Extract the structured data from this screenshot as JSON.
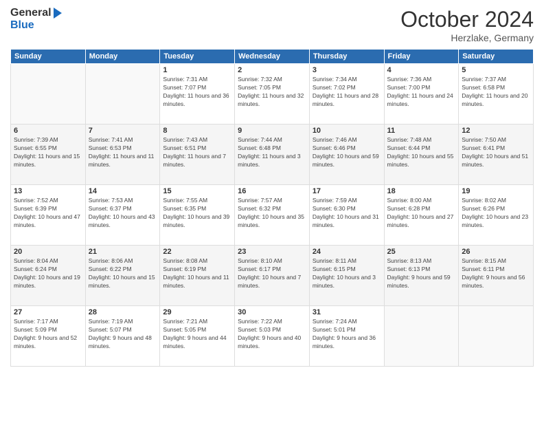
{
  "header": {
    "logo_general": "General",
    "logo_blue": "Blue",
    "month_title": "October 2024",
    "location": "Herzlake, Germany"
  },
  "weekdays": [
    "Sunday",
    "Monday",
    "Tuesday",
    "Wednesday",
    "Thursday",
    "Friday",
    "Saturday"
  ],
  "weeks": [
    [
      {
        "day": "",
        "sunrise": "",
        "sunset": "",
        "daylight": ""
      },
      {
        "day": "",
        "sunrise": "",
        "sunset": "",
        "daylight": ""
      },
      {
        "day": "1",
        "sunrise": "Sunrise: 7:31 AM",
        "sunset": "Sunset: 7:07 PM",
        "daylight": "Daylight: 11 hours and 36 minutes."
      },
      {
        "day": "2",
        "sunrise": "Sunrise: 7:32 AM",
        "sunset": "Sunset: 7:05 PM",
        "daylight": "Daylight: 11 hours and 32 minutes."
      },
      {
        "day": "3",
        "sunrise": "Sunrise: 7:34 AM",
        "sunset": "Sunset: 7:02 PM",
        "daylight": "Daylight: 11 hours and 28 minutes."
      },
      {
        "day": "4",
        "sunrise": "Sunrise: 7:36 AM",
        "sunset": "Sunset: 7:00 PM",
        "daylight": "Daylight: 11 hours and 24 minutes."
      },
      {
        "day": "5",
        "sunrise": "Sunrise: 7:37 AM",
        "sunset": "Sunset: 6:58 PM",
        "daylight": "Daylight: 11 hours and 20 minutes."
      }
    ],
    [
      {
        "day": "6",
        "sunrise": "Sunrise: 7:39 AM",
        "sunset": "Sunset: 6:55 PM",
        "daylight": "Daylight: 11 hours and 15 minutes."
      },
      {
        "day": "7",
        "sunrise": "Sunrise: 7:41 AM",
        "sunset": "Sunset: 6:53 PM",
        "daylight": "Daylight: 11 hours and 11 minutes."
      },
      {
        "day": "8",
        "sunrise": "Sunrise: 7:43 AM",
        "sunset": "Sunset: 6:51 PM",
        "daylight": "Daylight: 11 hours and 7 minutes."
      },
      {
        "day": "9",
        "sunrise": "Sunrise: 7:44 AM",
        "sunset": "Sunset: 6:48 PM",
        "daylight": "Daylight: 11 hours and 3 minutes."
      },
      {
        "day": "10",
        "sunrise": "Sunrise: 7:46 AM",
        "sunset": "Sunset: 6:46 PM",
        "daylight": "Daylight: 10 hours and 59 minutes."
      },
      {
        "day": "11",
        "sunrise": "Sunrise: 7:48 AM",
        "sunset": "Sunset: 6:44 PM",
        "daylight": "Daylight: 10 hours and 55 minutes."
      },
      {
        "day": "12",
        "sunrise": "Sunrise: 7:50 AM",
        "sunset": "Sunset: 6:41 PM",
        "daylight": "Daylight: 10 hours and 51 minutes."
      }
    ],
    [
      {
        "day": "13",
        "sunrise": "Sunrise: 7:52 AM",
        "sunset": "Sunset: 6:39 PM",
        "daylight": "Daylight: 10 hours and 47 minutes."
      },
      {
        "day": "14",
        "sunrise": "Sunrise: 7:53 AM",
        "sunset": "Sunset: 6:37 PM",
        "daylight": "Daylight: 10 hours and 43 minutes."
      },
      {
        "day": "15",
        "sunrise": "Sunrise: 7:55 AM",
        "sunset": "Sunset: 6:35 PM",
        "daylight": "Daylight: 10 hours and 39 minutes."
      },
      {
        "day": "16",
        "sunrise": "Sunrise: 7:57 AM",
        "sunset": "Sunset: 6:32 PM",
        "daylight": "Daylight: 10 hours and 35 minutes."
      },
      {
        "day": "17",
        "sunrise": "Sunrise: 7:59 AM",
        "sunset": "Sunset: 6:30 PM",
        "daylight": "Daylight: 10 hours and 31 minutes."
      },
      {
        "day": "18",
        "sunrise": "Sunrise: 8:00 AM",
        "sunset": "Sunset: 6:28 PM",
        "daylight": "Daylight: 10 hours and 27 minutes."
      },
      {
        "day": "19",
        "sunrise": "Sunrise: 8:02 AM",
        "sunset": "Sunset: 6:26 PM",
        "daylight": "Daylight: 10 hours and 23 minutes."
      }
    ],
    [
      {
        "day": "20",
        "sunrise": "Sunrise: 8:04 AM",
        "sunset": "Sunset: 6:24 PM",
        "daylight": "Daylight: 10 hours and 19 minutes."
      },
      {
        "day": "21",
        "sunrise": "Sunrise: 8:06 AM",
        "sunset": "Sunset: 6:22 PM",
        "daylight": "Daylight: 10 hours and 15 minutes."
      },
      {
        "day": "22",
        "sunrise": "Sunrise: 8:08 AM",
        "sunset": "Sunset: 6:19 PM",
        "daylight": "Daylight: 10 hours and 11 minutes."
      },
      {
        "day": "23",
        "sunrise": "Sunrise: 8:10 AM",
        "sunset": "Sunset: 6:17 PM",
        "daylight": "Daylight: 10 hours and 7 minutes."
      },
      {
        "day": "24",
        "sunrise": "Sunrise: 8:11 AM",
        "sunset": "Sunset: 6:15 PM",
        "daylight": "Daylight: 10 hours and 3 minutes."
      },
      {
        "day": "25",
        "sunrise": "Sunrise: 8:13 AM",
        "sunset": "Sunset: 6:13 PM",
        "daylight": "Daylight: 9 hours and 59 minutes."
      },
      {
        "day": "26",
        "sunrise": "Sunrise: 8:15 AM",
        "sunset": "Sunset: 6:11 PM",
        "daylight": "Daylight: 9 hours and 56 minutes."
      }
    ],
    [
      {
        "day": "27",
        "sunrise": "Sunrise: 7:17 AM",
        "sunset": "Sunset: 5:09 PM",
        "daylight": "Daylight: 9 hours and 52 minutes."
      },
      {
        "day": "28",
        "sunrise": "Sunrise: 7:19 AM",
        "sunset": "Sunset: 5:07 PM",
        "daylight": "Daylight: 9 hours and 48 minutes."
      },
      {
        "day": "29",
        "sunrise": "Sunrise: 7:21 AM",
        "sunset": "Sunset: 5:05 PM",
        "daylight": "Daylight: 9 hours and 44 minutes."
      },
      {
        "day": "30",
        "sunrise": "Sunrise: 7:22 AM",
        "sunset": "Sunset: 5:03 PM",
        "daylight": "Daylight: 9 hours and 40 minutes."
      },
      {
        "day": "31",
        "sunrise": "Sunrise: 7:24 AM",
        "sunset": "Sunset: 5:01 PM",
        "daylight": "Daylight: 9 hours and 36 minutes."
      },
      {
        "day": "",
        "sunrise": "",
        "sunset": "",
        "daylight": ""
      },
      {
        "day": "",
        "sunrise": "",
        "sunset": "",
        "daylight": ""
      }
    ]
  ]
}
